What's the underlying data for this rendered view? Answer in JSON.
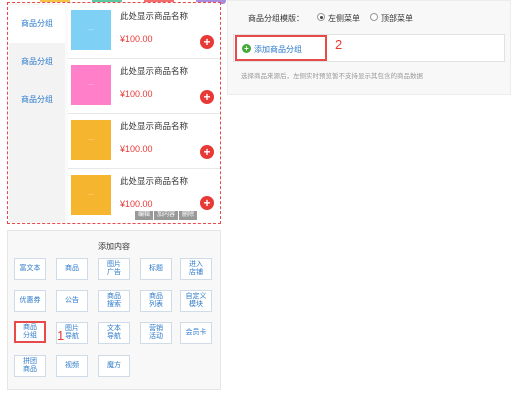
{
  "categories": [
    "商品分组",
    "商品分组",
    "商品分组"
  ],
  "products": [
    {
      "name": "此处显示商品名称",
      "price": "¥100.00",
      "thumb_color": "#7fd0f5"
    },
    {
      "name": "此处显示商品名称",
      "price": "¥100.00",
      "thumb_color": "#ff7fc8"
    },
    {
      "name": "此处显示商品名称",
      "price": "¥100.00",
      "thumb_color": "#f5b52e"
    },
    {
      "name": "此处显示商品名称",
      "price": "¥100.00",
      "thumb_color": "#f5b52e"
    }
  ],
  "add_icon": "plus-icon",
  "actions": [
    "编辑",
    "加内容",
    "删除"
  ],
  "add_panel": {
    "title": "添加内容",
    "components": [
      "富文本",
      "商品",
      "图片\n广告",
      "标题",
      "进入\n店铺",
      "优惠券",
      "公告",
      "商品\n搜索",
      "商品\n列表",
      "自定义\n模块",
      "商品\n分组",
      "图片\n导航",
      "文本\n导航",
      "营销\n活动",
      "会员卡",
      "拼团\n商品",
      "视频",
      "魔方"
    ]
  },
  "annotations": {
    "one": "1",
    "two": "2"
  },
  "settings": {
    "template_label": "商品分组模版：",
    "option_left": "左侧菜单",
    "option_top": "顶部菜单",
    "add_group_label": "添加商品分组",
    "hint": "选择商品来源后，左侧实时预览暂不支持显示其包含的商品数据"
  },
  "colors": {
    "accent_red": "#e73935",
    "link_blue": "#2b79c9",
    "add_green": "#45a838"
  }
}
